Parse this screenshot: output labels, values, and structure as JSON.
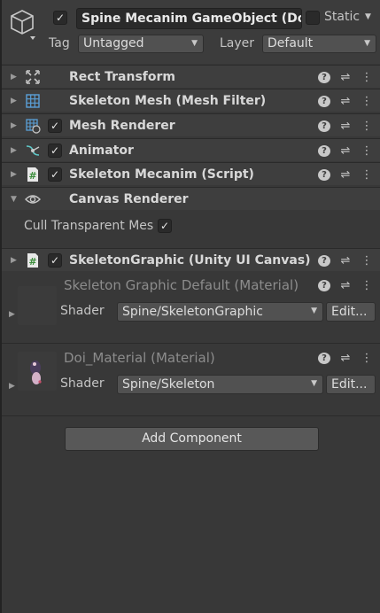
{
  "header": {
    "object_name": "Spine Mecanim GameObject (Doi)",
    "active_checked": "✓",
    "static_label": "Static",
    "tag_label": "Tag",
    "tag_value": "Untagged",
    "layer_label": "Layer",
    "layer_value": "Default"
  },
  "components": [
    {
      "name": "Rect Transform",
      "icon": "rect-transform-icon",
      "has_checkbox": false
    },
    {
      "name": "Skeleton Mesh (Mesh Filter)",
      "icon": "mesh-filter-icon",
      "has_checkbox": false
    },
    {
      "name": "Mesh Renderer",
      "icon": "mesh-renderer-icon",
      "has_checkbox": true,
      "check": "✓"
    },
    {
      "name": "Animator",
      "icon": "animator-icon",
      "has_checkbox": true,
      "check": "✓"
    },
    {
      "name": "Skeleton Mecanim (Script)",
      "icon": "script-icon",
      "has_checkbox": true,
      "check": "✓"
    },
    {
      "name": "Canvas Renderer",
      "icon": "eye-icon",
      "has_checkbox": false
    },
    {
      "name": "SkeletonGraphic (Unity UI Canvas)",
      "icon": "script-icon",
      "has_checkbox": true,
      "check": "✓"
    }
  ],
  "canvas_renderer": {
    "cull_label": "Cull Transparent Mes",
    "cull_check": "✓"
  },
  "materials": [
    {
      "title": "Skeleton Graphic Default (Material)",
      "shader_label": "Shader",
      "shader_value": "Spine/SkeletonGraphic",
      "edit_label": "Edit..."
    },
    {
      "title": "Doi_Material (Material)",
      "shader_label": "Shader",
      "shader_value": "Spine/Skeleton",
      "edit_label": "Edit..."
    }
  ],
  "tool_glyphs": {
    "help": "?",
    "presets": "⇌",
    "menu": "⋮"
  },
  "add_component_label": "Add Component",
  "colors": {
    "panel": "#383838",
    "header_row": "#3e3e3e",
    "script_icon": "#3b8e3b"
  }
}
